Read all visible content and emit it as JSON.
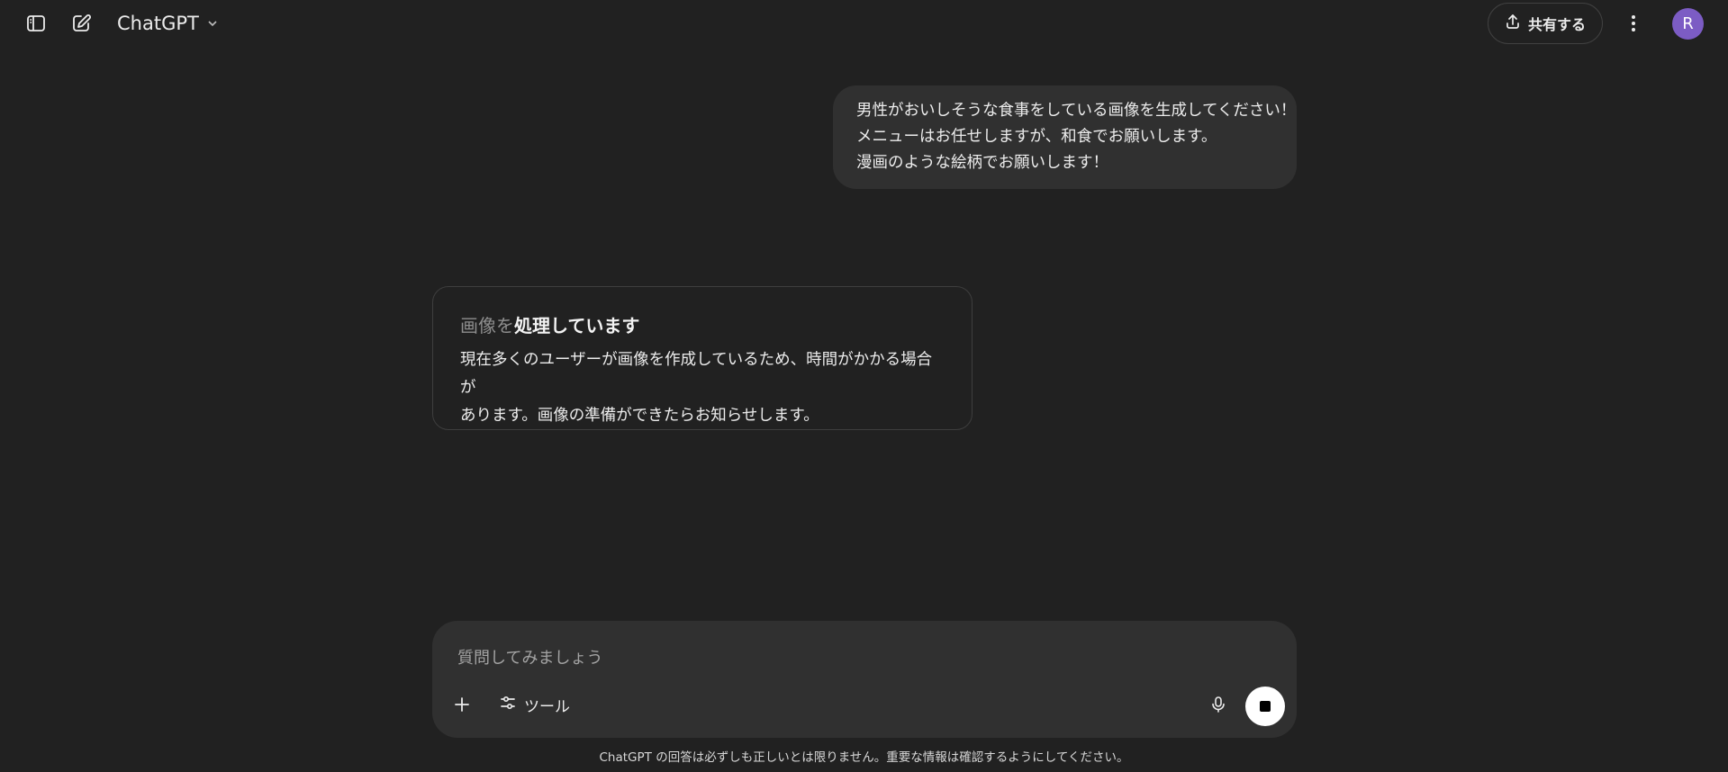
{
  "header": {
    "model_name": "ChatGPT",
    "share_label": "共有する",
    "avatar_initial": "R"
  },
  "conversation": {
    "user_message_lines": [
      "男性がおいしそうな食事をしている画像を生成してください！",
      "メニューはお任せしますが、和食でお願いします。",
      "漫画のような絵柄でお願いします！"
    ],
    "processing": {
      "title_dim": "画像を",
      "title_strong": "処理しています",
      "body_lines": [
        "現在多くのユーザーが画像を作成しているため、時間がかかる場合が",
        "あります。画像の準備ができたらお知らせします。"
      ]
    }
  },
  "composer": {
    "placeholder": "質問してみましょう",
    "tools_label": "ツール"
  },
  "footer": {
    "disclaimer": "ChatGPT の回答は必ずしも正しいとは限りません。重要な情報は確認するようにしてください。"
  },
  "icons": {
    "sidebar_toggle": "sidebar-icon",
    "new_chat": "edit-icon",
    "model_dropdown": "chevron-down-icon",
    "share": "upload-icon",
    "more": "more-vertical-icon",
    "plus": "plus-icon",
    "tools": "sliders-icon",
    "mic": "mic-icon",
    "stop": "stop-icon"
  },
  "colors": {
    "background": "#212121",
    "bubble": "#303030",
    "avatar": "#7c5cc4"
  }
}
